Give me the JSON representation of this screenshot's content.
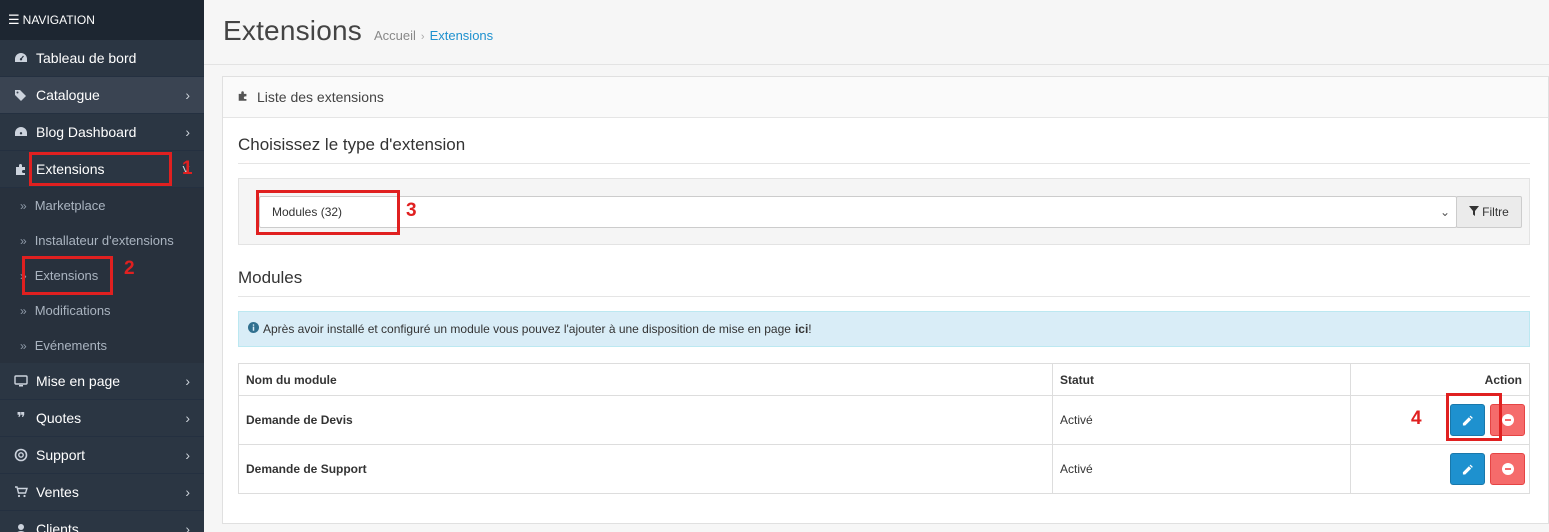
{
  "sidebar": {
    "header": "NAVIGATION",
    "items": [
      {
        "label": "Tableau de bord",
        "icon": "dashboard-icon",
        "has_arrow": false
      },
      {
        "label": "Catalogue",
        "icon": "tags-icon",
        "has_arrow": true
      },
      {
        "label": "Blog Dashboard",
        "icon": "dashboard-icon",
        "has_arrow": true
      },
      {
        "label": "Extensions",
        "icon": "puzzle-icon",
        "has_arrow": true,
        "arrow": "˅"
      }
    ],
    "sub_items": [
      {
        "label": "Marketplace"
      },
      {
        "label": "Installateur d'extensions"
      },
      {
        "label": "Extensions"
      },
      {
        "label": "Modifications"
      },
      {
        "label": "Evénements"
      }
    ],
    "items_after": [
      {
        "label": "Mise en page",
        "icon": "desktop-icon"
      },
      {
        "label": "Quotes",
        "icon": "quote-icon"
      },
      {
        "label": "Support",
        "icon": "life-ring-icon"
      },
      {
        "label": "Ventes",
        "icon": "cart-icon"
      },
      {
        "label": "Clients",
        "icon": "user-icon"
      }
    ]
  },
  "header": {
    "title": "Extensions",
    "breadcrumb": [
      "Accueil",
      "Extensions"
    ]
  },
  "panel": {
    "title": "Liste des extensions",
    "choose_heading": "Choisissez le type d'extension",
    "select_value": "Modules (32)",
    "filter_label": "Filtre",
    "modules_heading": "Modules",
    "alert_text": "Après avoir installé et configuré un module vous pouvez l'ajouter à une disposition de mise en page",
    "alert_link": "ici",
    "alert_end": " !"
  },
  "table": {
    "headers": [
      "Nom du module",
      "Statut",
      "Action"
    ],
    "rows": [
      {
        "name": "Demande de Devis",
        "status": "Activé"
      },
      {
        "name": "Demande de Support",
        "status": "Activé"
      }
    ]
  },
  "annotations": {
    "n1": "1",
    "n2": "2",
    "n3": "3",
    "n4": "4"
  },
  "colors": {
    "accent": "#1e91cf",
    "danger": "#f56b6b",
    "annotation": "#e02020"
  }
}
